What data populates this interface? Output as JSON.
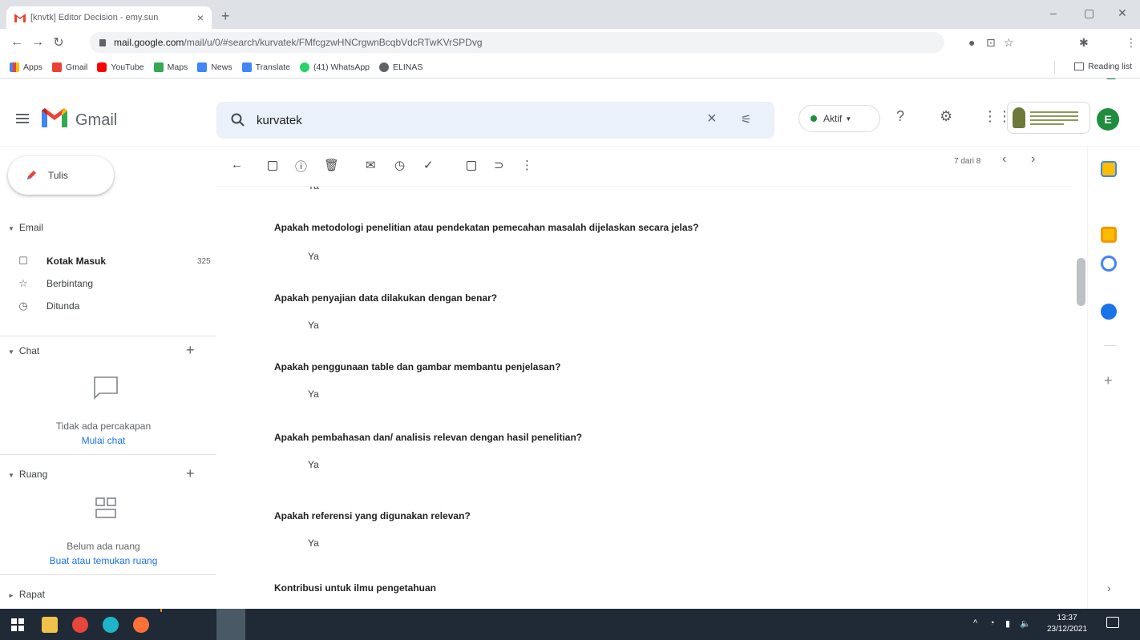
{
  "browser": {
    "tab_title": "[knvtk] Editor Decision - emy.sun",
    "address_domain": "mail.google.com",
    "address_path": "/mail/u/0/#search/kurvatek/FMfcgzwHNCrgwnBcqbVdcRTwKVrSPDvg",
    "bookmarks": [
      "Apps",
      "Gmail",
      "YouTube",
      "Maps",
      "News",
      "Translate",
      "(41) WhatsApp",
      "ELINAS"
    ],
    "reading_list": "Reading list",
    "profile_initial": "E"
  },
  "gmail": {
    "logo_text": "Gmail",
    "search_value": "kurvatek",
    "status": "Aktif",
    "avatar_initial": "E"
  },
  "sidebar": {
    "compose": "Tulis",
    "email_section": "Email",
    "items": [
      {
        "label": "Kotak Masuk",
        "count": "325"
      },
      {
        "label": "Berbintang"
      },
      {
        "label": "Ditunda"
      }
    ],
    "chat_section": "Chat",
    "chat_empty": "Tidak ada percakapan",
    "chat_link": "Mulai chat",
    "ruang_section": "Ruang",
    "ruang_empty": "Belum ada ruang",
    "ruang_link": "Buat atau temukan ruang",
    "rapat_section": "Rapat"
  },
  "toolbar": {
    "pager": "7 dari 8"
  },
  "message": {
    "partial_answer": "Ya",
    "qa": [
      {
        "q": "Apakah metodologi penelitian atau pendekatan pemecahan masalah dijelaskan secara jelas?",
        "a": "Ya"
      },
      {
        "q": "Apakah penyajian data dilakukan dengan benar?",
        "a": "Ya"
      },
      {
        "q": "Apakah penggunaan table dan gambar membantu penjelasan?",
        "a": "Ya"
      },
      {
        "q": "Apakah pembahasan dan/ analisis relevan dengan hasil penelitian?",
        "a": "Ya"
      },
      {
        "q": "Apakah referensi yang digunakan relevan?",
        "a": "Ya"
      },
      {
        "q": "Kontribusi untuk ilmu pengetahuan",
        "a": ""
      }
    ]
  },
  "taskbar": {
    "time": "13:37",
    "date": "23/12/2021"
  },
  "colors": {
    "gmail_red": "#ea4335",
    "link_blue": "#1a73e8",
    "search_bg": "#eaf1fb",
    "status_green": "#1e8e3e",
    "taskbar_bg": "#1f2a36"
  }
}
